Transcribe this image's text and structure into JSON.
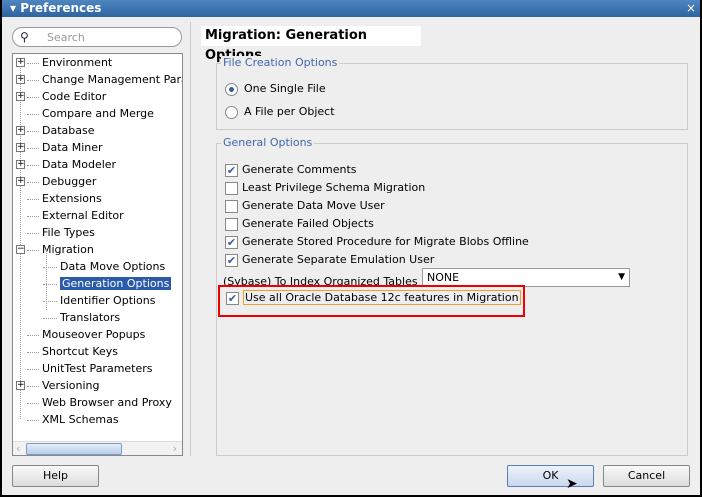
{
  "window": {
    "title": "Preferences",
    "close": "×"
  },
  "search": {
    "placeholder": "Search"
  },
  "tree": {
    "items": [
      {
        "label": "Environment",
        "exp": "+",
        "level": 0
      },
      {
        "label": "Change Management Param",
        "exp": "+",
        "level": 0
      },
      {
        "label": "Code Editor",
        "exp": "+",
        "level": 0
      },
      {
        "label": "Compare and Merge",
        "exp": "",
        "level": 0
      },
      {
        "label": "Database",
        "exp": "+",
        "level": 0
      },
      {
        "label": "Data Miner",
        "exp": "+",
        "level": 0
      },
      {
        "label": "Data Modeler",
        "exp": "+",
        "level": 0
      },
      {
        "label": "Debugger",
        "exp": "+",
        "level": 0
      },
      {
        "label": "Extensions",
        "exp": "",
        "level": 0
      },
      {
        "label": "External Editor",
        "exp": "",
        "level": 0
      },
      {
        "label": "File Types",
        "exp": "",
        "level": 0
      },
      {
        "label": "Migration",
        "exp": "−",
        "level": 0
      },
      {
        "label": "Data Move Options",
        "exp": "",
        "level": 1
      },
      {
        "label": "Generation Options",
        "exp": "",
        "level": 1,
        "selected": true
      },
      {
        "label": "Identifier Options",
        "exp": "",
        "level": 1
      },
      {
        "label": "Translators",
        "exp": "",
        "level": 1
      },
      {
        "label": "Mouseover Popups",
        "exp": "",
        "level": 0
      },
      {
        "label": "Shortcut Keys",
        "exp": "",
        "level": 0
      },
      {
        "label": "UnitTest Parameters",
        "exp": "",
        "level": 0
      },
      {
        "label": "Versioning",
        "exp": "+",
        "level": 0
      },
      {
        "label": "Web Browser and Proxy",
        "exp": "",
        "level": 0
      },
      {
        "label": "XML Schemas",
        "exp": "",
        "level": 0
      }
    ]
  },
  "page": {
    "title": "Migration: Generation Options"
  },
  "file_creation": {
    "label": "File Creation Options",
    "options": [
      {
        "label": "One Single File",
        "selected": true
      },
      {
        "label": "A File per Object",
        "selected": false
      }
    ]
  },
  "general": {
    "label": "General Options",
    "checkboxes": [
      {
        "label": "Generate Comments",
        "checked": true
      },
      {
        "label": "Least Privilege Schema Migration",
        "checked": false
      },
      {
        "label": "Generate Data Move User",
        "checked": false
      },
      {
        "label": "Generate Failed Objects",
        "checked": false
      },
      {
        "label": "Generate Stored Procedure for Migrate Blobs Offline",
        "checked": true
      },
      {
        "label": "Generate Separate Emulation User",
        "checked": true
      }
    ],
    "iot_label": "(Sybase) To Index Organized Tables",
    "iot_value": "NONE",
    "oracle12c": {
      "label": "Use all Oracle Database 12c features in Migration",
      "checked": true
    }
  },
  "buttons": {
    "help": "Help",
    "ok": "OK",
    "cancel": "Cancel"
  },
  "colors": {
    "highlight": "#e00000",
    "selection": "#2b5aa8"
  }
}
